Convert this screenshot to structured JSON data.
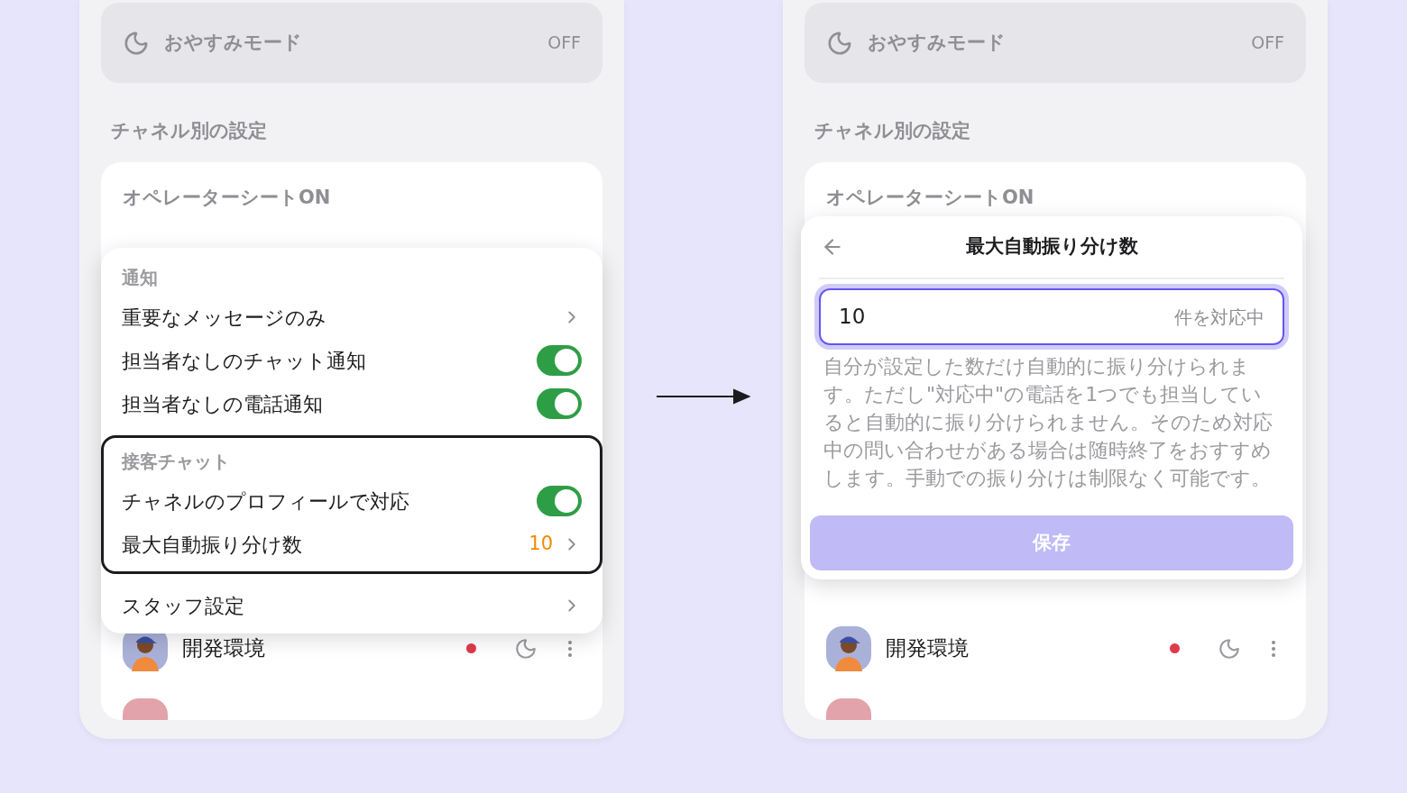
{
  "panels": [
    {
      "night_mode": {
        "label": "おやすみモード",
        "status": "OFF"
      },
      "section_title": "チャネル別の設定",
      "card": {
        "title": "オペレーターシートON",
        "rows": [
          {
            "name": "開発環境",
            "unread_dot": true,
            "away": true
          }
        ]
      },
      "overlay": {
        "kind": "menu",
        "sections": [
          {
            "title": "通知",
            "highlighted": false,
            "items": [
              {
                "kind": "link",
                "label": "重要なメッセージのみ"
              },
              {
                "kind": "toggle",
                "label": "担当者なしのチャット通知",
                "on": true
              },
              {
                "kind": "toggle",
                "label": "担当者なしの電話通知",
                "on": true
              }
            ]
          },
          {
            "title": "接客チャット",
            "highlighted": true,
            "items": [
              {
                "kind": "toggle",
                "label": "チャネルのプロフィールで対応",
                "on": true
              },
              {
                "kind": "link",
                "label": "最大自動振り分け数",
                "value": "10"
              }
            ]
          },
          {
            "highlighted": false,
            "items": [
              {
                "kind": "link",
                "label": "スタッフ設定"
              }
            ]
          }
        ]
      }
    },
    {
      "night_mode": {
        "label": "おやすみモード",
        "status": "OFF"
      },
      "section_title": "チャネル別の設定",
      "card": {
        "title": "オペレーターシートON",
        "rows": [
          {
            "name": "開発環境",
            "unread_dot": true,
            "away": true
          }
        ]
      },
      "overlay": {
        "kind": "dialog",
        "title": "最大自動振り分け数",
        "input": {
          "value": "10",
          "suffix": "件を対応中",
          "focused": true
        },
        "description": "自分が設定した数だけ自動的に振り分けられます。ただし\"対応中\"の電話を1つでも担当していると自動的に振り分けられません。そのため対応中の問い合わせがある場合は随時終了をおすすめします。手動での振り分けは制限なく可能です。",
        "button": {
          "label": "保存",
          "disabled": true
        }
      }
    }
  ]
}
